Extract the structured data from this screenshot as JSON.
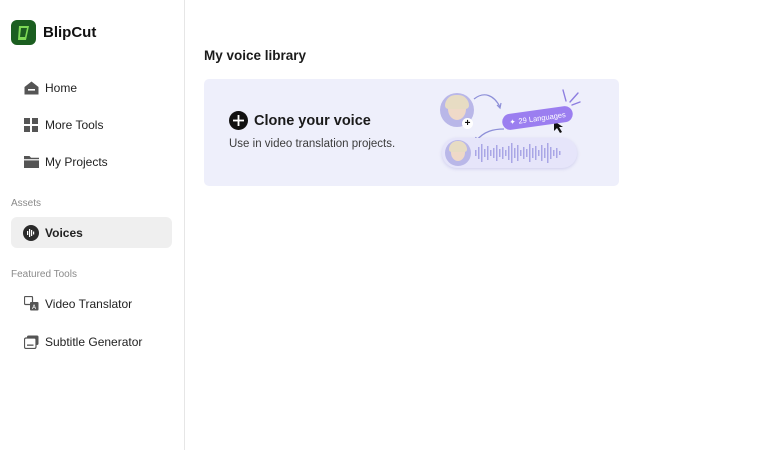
{
  "brand": {
    "name": "BlipCut"
  },
  "nav": {
    "home": "Home",
    "more_tools": "More Tools",
    "my_projects": "My Projects"
  },
  "sections": {
    "assets": "Assets",
    "featured_tools": "Featured Tools"
  },
  "assets_items": {
    "voices": "Voices"
  },
  "featured_items": {
    "video_translator": "Video Translator",
    "subtitle_generator": "Subtitle Generator"
  },
  "main": {
    "title": "My voice library",
    "clone_card": {
      "title": "Clone your voice",
      "description": "Use in video translation projects.",
      "languages_badge": "29 Languages"
    }
  },
  "colors": {
    "brand": "#1b5e20",
    "card_bg": "#eeeffb",
    "accent_purple": "#9b7ef0",
    "active_bg": "#efefef"
  },
  "icons": {
    "home": "home-icon",
    "more_tools": "grid-icon",
    "my_projects": "folder-icon",
    "voices": "waveform-icon",
    "video_translator": "translate-icon",
    "subtitle_generator": "subtitle-icon",
    "clone": "plus-circle-icon"
  }
}
